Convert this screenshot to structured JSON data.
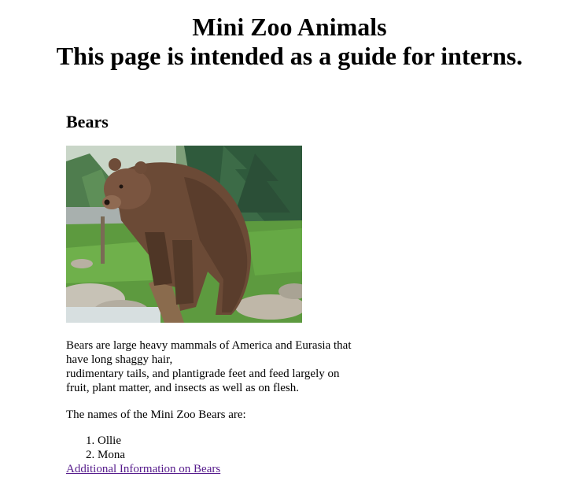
{
  "header": {
    "title": "Mini Zoo Animals",
    "subtitle": "This page is intended as a guide for interns."
  },
  "section": {
    "title": "Bears",
    "image_subject": "brown bear standing on a log in a green enclosure",
    "description_lines": [
      "Bears are large heavy mammals of America and Eurasia that",
      "have long shaggy hair,",
      "rudimentary tails, and plantigrade feet and feed largely on",
      "fruit, plant matter, and insects as well as on flesh."
    ],
    "names_intro": "The names of the Mini Zoo Bears are:",
    "names": [
      "Ollie",
      "Mona"
    ],
    "link_text": "Additional Information on Bears"
  },
  "colors": {
    "visited_link": "#551a8b",
    "text": "#000000",
    "background": "#ffffff"
  }
}
